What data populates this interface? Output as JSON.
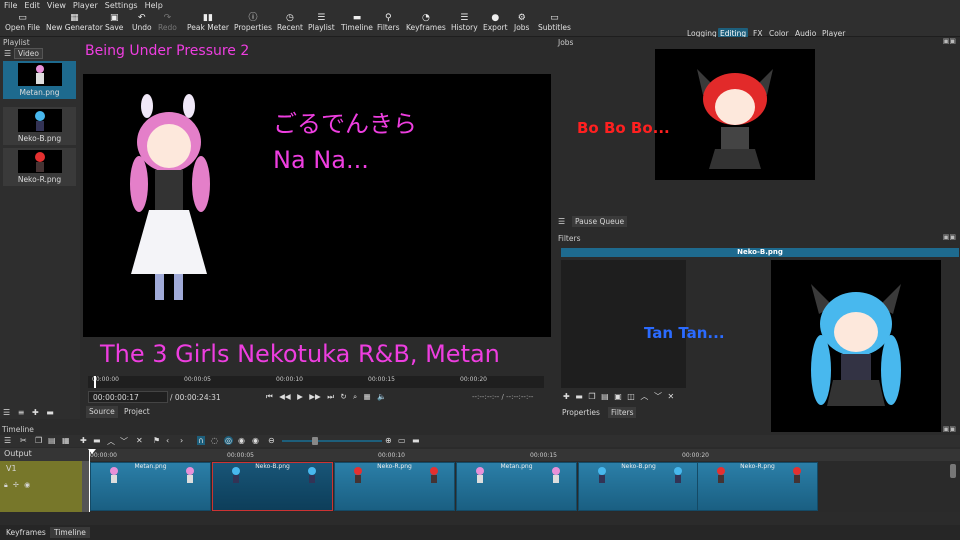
{
  "menu": [
    "File",
    "Edit",
    "View",
    "Player",
    "Settings",
    "Help"
  ],
  "toolbar": [
    {
      "label": "Open File",
      "icon": "folder-icon"
    },
    {
      "label": "New Generator",
      "icon": "generator-icon"
    },
    {
      "label": "Save",
      "icon": "save-icon"
    },
    {
      "label": "Undo",
      "icon": "undo-icon"
    },
    {
      "label": "Redo",
      "icon": "redo-icon"
    },
    {
      "label": "Peak Meter",
      "icon": "peak-meter-icon"
    },
    {
      "label": "Properties",
      "icon": "properties-icon"
    },
    {
      "label": "Recent",
      "icon": "recent-icon"
    },
    {
      "label": "Playlist",
      "icon": "playlist-icon"
    },
    {
      "label": "Timeline",
      "icon": "timeline-icon"
    },
    {
      "label": "Filters",
      "icon": "filters-icon"
    },
    {
      "label": "Keyframes",
      "icon": "keyframes-icon"
    },
    {
      "label": "History",
      "icon": "history-icon"
    },
    {
      "label": "Export",
      "icon": "export-icon"
    },
    {
      "label": "Jobs",
      "icon": "jobs-icon"
    },
    {
      "label": "Subtitles",
      "icon": "subtitles-icon"
    }
  ],
  "layouts": [
    "Logging",
    "Editing",
    "FX",
    "Color",
    "Audio",
    "Player"
  ],
  "active_layout": "Editing",
  "playlist": {
    "title": "Playlist",
    "filter": "Video",
    "items": [
      "Metan.png",
      "Neko-B.png",
      "Neko-R.png"
    ]
  },
  "player": {
    "title_text": "Being Under Pressure 2",
    "line1": "ごるでんきら",
    "line2": "Na Na...",
    "caption": "The 3 Girls Nekotuka R&B, Metan",
    "ruler": [
      "00:00:00",
      "00:00:05",
      "00:00:10",
      "00:00:15",
      "00:00:20"
    ],
    "position": "00:00:00:17",
    "duration": "/ 00:00:24:31",
    "in_out": "--:--:--:-- / --:--:--:--",
    "tabs": [
      "Source",
      "Project"
    ]
  },
  "jobs": {
    "title": "Jobs",
    "overlay_text": "Bo Bo Bo...",
    "pause_queue": "Pause Queue"
  },
  "filters": {
    "title": "Filters",
    "current_clip": "Neko-B.png",
    "overlay_text": "Tan Tan...",
    "tabs": [
      "Properties",
      "Filters"
    ]
  },
  "timeline": {
    "title": "Timeline",
    "output": "Output",
    "track": "V1",
    "ruler": [
      "00:00:00",
      "00:00:05",
      "00:00:10",
      "00:00:15",
      "00:00:20"
    ],
    "clips": [
      "Metan.png",
      "Neko-B.png",
      "Neko-R.png",
      "Metan.png",
      "Neko-B.png",
      "Neko-R.png"
    ]
  },
  "bottom_tabs": [
    "Keyframes",
    "Timeline"
  ],
  "colors": {
    "accent": "#1d5f7c",
    "pink_text": "#ee3ee0",
    "red_text": "#ff2020",
    "blue_text": "#2b6bff",
    "track_head": "#77772a"
  }
}
